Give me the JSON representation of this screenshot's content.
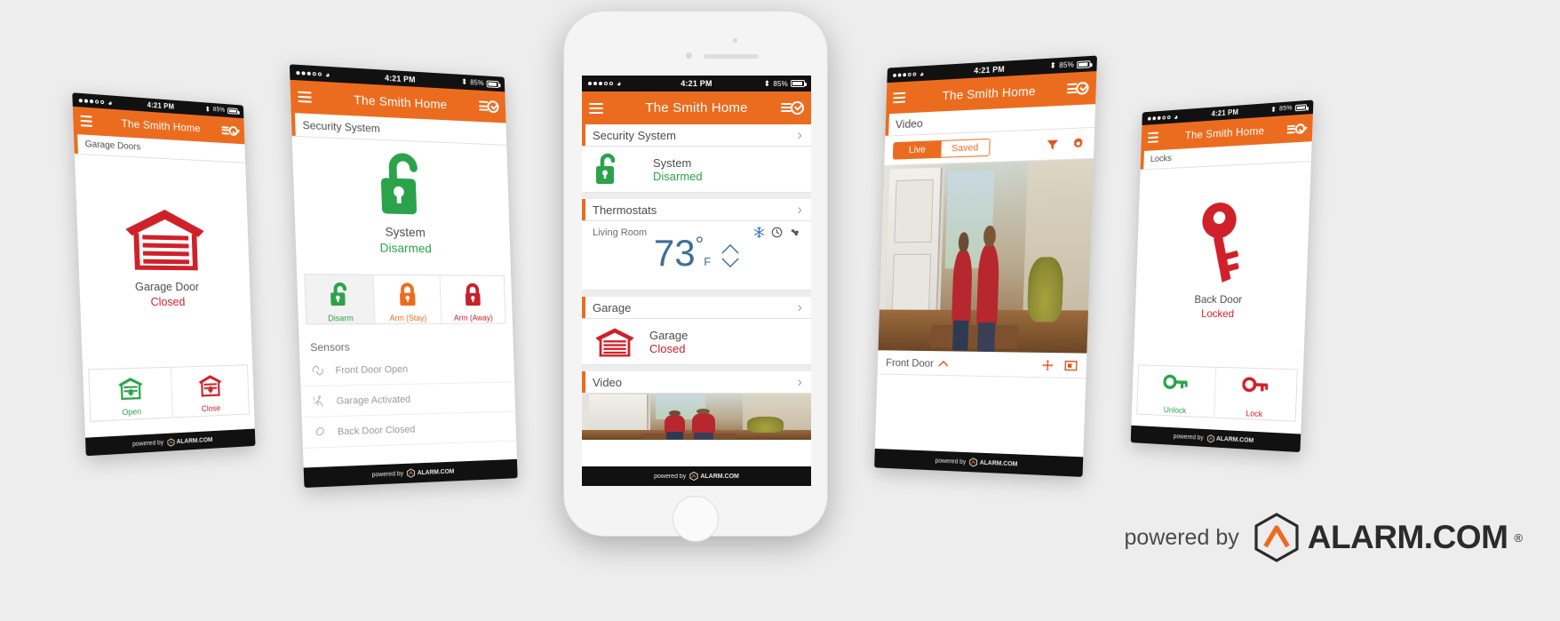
{
  "brand": {
    "powered_by": "powered by",
    "name": "ALARM.COM",
    "tm": "®",
    "footer_small": "powered by",
    "footer_name": "ALARM.COM",
    "accent_orange": "#ec6c1f",
    "green": "#2ba34a",
    "red": "#cf202a",
    "blue": "#3e6e96"
  },
  "status_bar": {
    "time": "4:21 PM",
    "battery": "85%",
    "bluetooth_icon": "bluetooth-icon",
    "wifi_icon": "wifi-icon",
    "carrier_dots": "●●●○○"
  },
  "nav": {
    "title": "The Smith Home",
    "menu_icon": "hamburger-menu-icon",
    "history_icon": "activity-history-icon"
  },
  "phone1": {
    "section": "Garage Doors",
    "device_icon": "garage-door-closed-icon",
    "device_name": "Garage Door",
    "device_state": "Closed",
    "buttons": [
      {
        "label": "Open",
        "icon": "garage-open-icon",
        "color": "green"
      },
      {
        "label": "Close",
        "icon": "garage-close-icon",
        "color": "red"
      }
    ]
  },
  "phone2": {
    "section": "Security System",
    "device_icon": "unlocked-padlock-icon",
    "device_name": "System",
    "device_state": "Disarmed",
    "buttons": [
      {
        "label": "Disarm",
        "icon": "unlock-icon",
        "color": "green",
        "selected": true
      },
      {
        "label": "Arm (Stay)",
        "icon": "lock-icon",
        "color": "orange",
        "selected": false
      },
      {
        "label": "Arm (Away)",
        "icon": "lock-icon",
        "color": "red",
        "selected": false
      }
    ],
    "sensors_header": "Sensors",
    "sensors": [
      {
        "label": "Front Door Open",
        "icon": "contact-sensor-icon"
      },
      {
        "label": "Garage Activated",
        "icon": "motion-sensor-icon"
      },
      {
        "label": "Back Door Closed",
        "icon": "contact-sensor-closed-icon"
      }
    ]
  },
  "phone3": {
    "cards": [
      {
        "title": "Security System",
        "chevron": "›",
        "name": "System",
        "state": "Disarmed",
        "state_color": "green",
        "icon": "unlocked-padlock-icon"
      },
      {
        "title": "Thermostats",
        "chevron": "›",
        "zone": "Living Room",
        "temperature": "73",
        "degree": "°",
        "unit": "F",
        "mode_icons": [
          "snowflake-icon",
          "clock-icon",
          "fan-icon"
        ],
        "stepper": {
          "up": "chevron-up-icon",
          "down": "chevron-down-icon"
        }
      },
      {
        "title": "Garage",
        "chevron": "›",
        "name": "Garage",
        "state": "Closed",
        "state_color": "red",
        "icon": "garage-door-closed-icon"
      },
      {
        "title": "Video",
        "chevron": "›",
        "icon": "video-thumbnail"
      }
    ]
  },
  "phone4": {
    "section": "Video",
    "tabs": [
      {
        "label": "Live",
        "active": true
      },
      {
        "label": "Saved",
        "active": false
      }
    ],
    "filter_icon": "funnel-filter-icon",
    "settings_icon": "gear-settings-icon",
    "camera_label": "Front Door",
    "collapse_icon": "chevron-up-icon",
    "move_icon": "pan-move-icon",
    "fullscreen_icon": "fullscreen-icon"
  },
  "phone5": {
    "section": "Locks",
    "device_icon": "key-locked-icon",
    "device_name": "Back Door",
    "device_state": "Locked",
    "buttons": [
      {
        "label": "Unlock",
        "icon": "key-unlock-icon",
        "color": "green"
      },
      {
        "label": "Lock",
        "icon": "key-lock-icon",
        "color": "red"
      }
    ]
  }
}
